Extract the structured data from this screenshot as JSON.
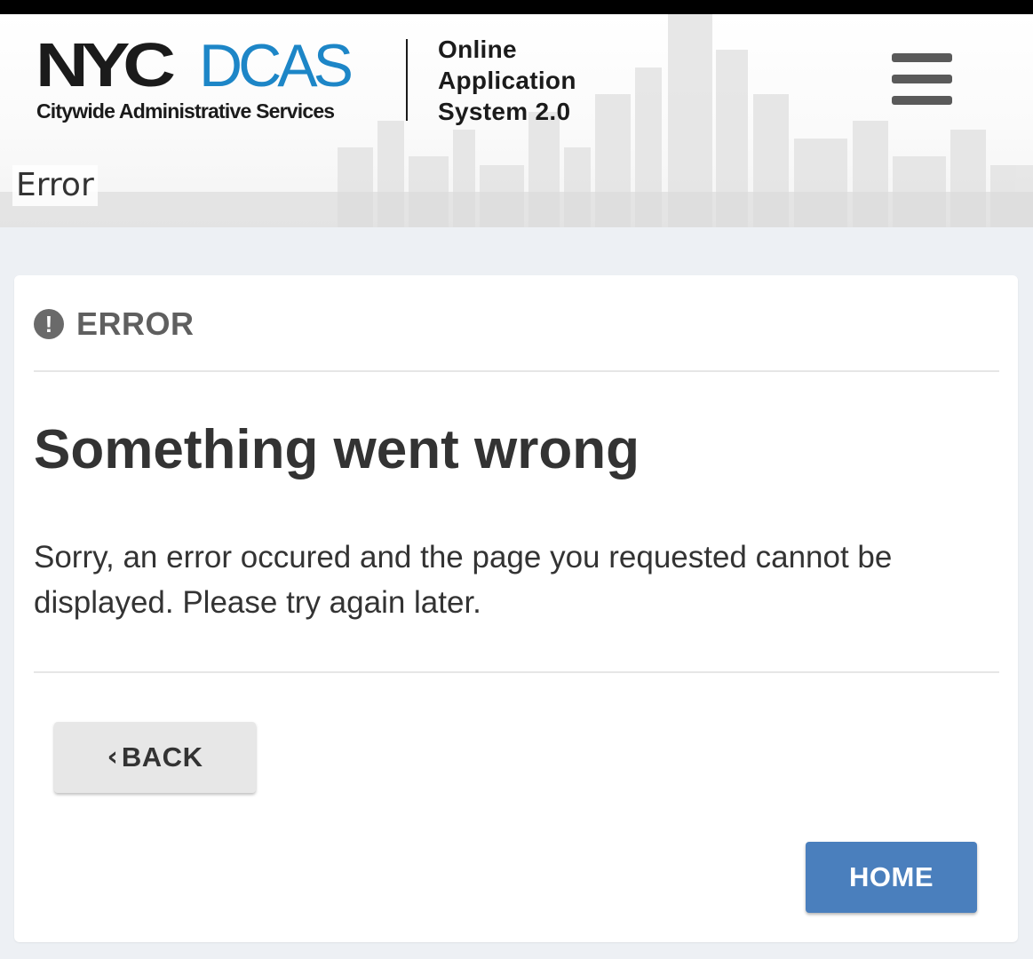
{
  "header": {
    "logo_mark": "NYC",
    "logo_agency": "DCAS",
    "logo_subtitle": "Citywide Administrative Services",
    "app_title_lines": [
      "Online",
      "Application",
      "System 2.0"
    ],
    "menu_icon": "hamburger-menu-icon",
    "page_heading": "Error"
  },
  "card": {
    "head_icon": "exclamation-circle-icon",
    "head_label": "ERROR",
    "headline": "Something went wrong",
    "message": "Sorry, an error occured and the page you requested cannot be displayed. Please try again later.",
    "back_icon": "chevron-left-icon",
    "back_label": "BACK",
    "home_label": "HOME"
  },
  "colors": {
    "brand_blue": "#1d86c7",
    "home_button": "#4a7fbd",
    "back_button": "#e7e7e7",
    "page_background": "#edf0f4"
  }
}
